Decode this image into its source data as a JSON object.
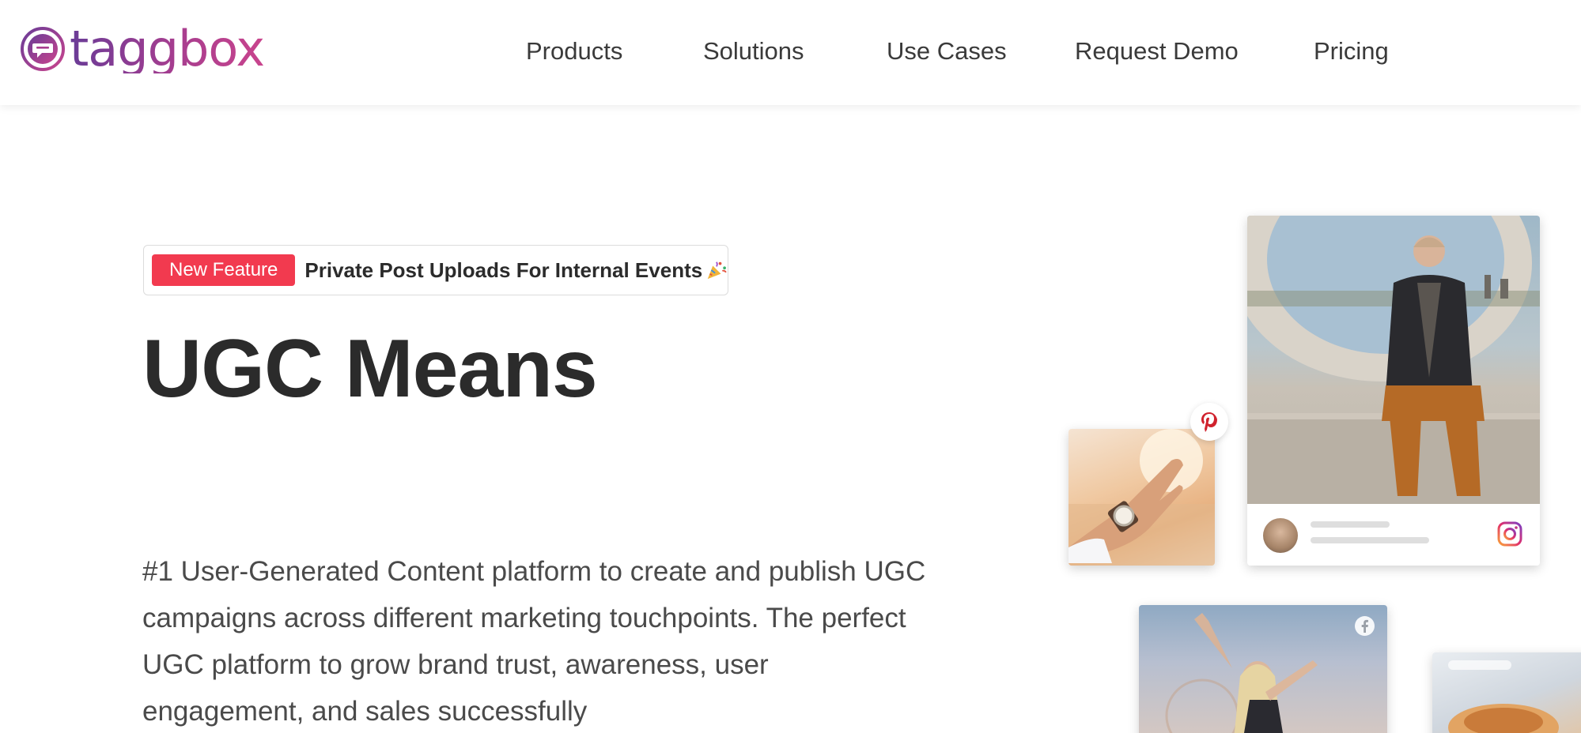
{
  "header": {
    "logo_text": "taggbox",
    "nav": [
      {
        "label": "Products"
      },
      {
        "label": "Solutions"
      },
      {
        "label": "Use Cases"
      },
      {
        "label": "Request Demo"
      },
      {
        "label": "Pricing"
      }
    ]
  },
  "feature_pill": {
    "badge": "New Feature",
    "text": "Private Post Uploads For Internal Events",
    "icon": "party-popper-icon"
  },
  "hero": {
    "title": "UGC Means",
    "description": "#1 User-Generated Content platform to create and publish UGC campaigns across different marketing touchpoints. The perfect UGC platform to grow brand trust, awareness, user engagement, and sales successfully"
  },
  "cards": {
    "icons": [
      "pinterest-icon",
      "instagram-icon",
      "facebook-icon"
    ]
  },
  "colors": {
    "brand_purple": "#6a3c97",
    "brand_pink": "#c9448d",
    "badge_red": "#f23a4f",
    "text_dark": "#2b2b2b"
  }
}
